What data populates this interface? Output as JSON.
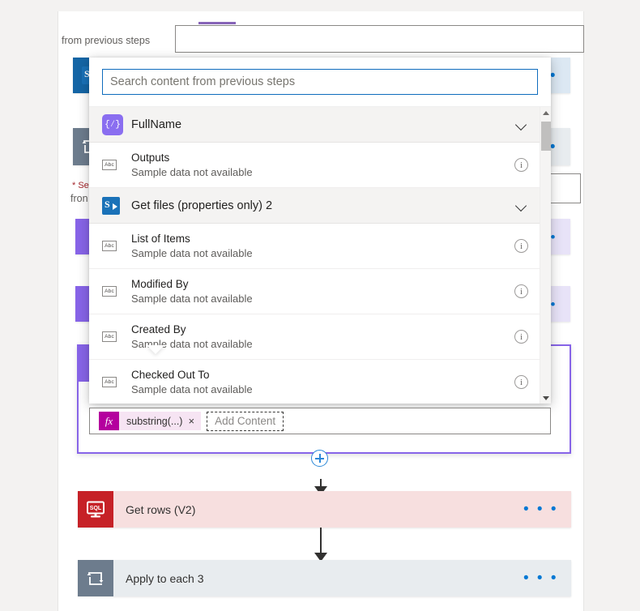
{
  "canvas": {
    "partial_label_top": "from previous steps",
    "required_label_line1": "* Se",
    "required_label_line2": "fron"
  },
  "cards": [
    {
      "name": "sharepoint-card",
      "title": "",
      "type": "sharepoint"
    },
    {
      "name": "apply-to-each-2",
      "title": "",
      "type": "loop"
    }
  ],
  "popup": {
    "search": {
      "placeholder": "Search content from previous steps",
      "value": ""
    },
    "groups": [
      {
        "name": "FullName",
        "icon": "expression-icon",
        "icon_glyph": "{⁄}",
        "chevron": "chevron-down-icon",
        "items": [
          {
            "title": "Outputs",
            "subtitle": "Sample data not available",
            "icon": "abc-icon",
            "info": "info-icon"
          }
        ]
      },
      {
        "name": "Get files (properties only) 2",
        "icon": "sharepoint-icon",
        "chevron": "chevron-down-icon",
        "items": [
          {
            "title": "List of Items",
            "subtitle": "Sample data not available",
            "icon": "abc-icon",
            "info": "info-icon"
          },
          {
            "title": "Modified By",
            "subtitle": "Sample data not available",
            "icon": "abc-icon",
            "info": "info-icon"
          },
          {
            "title": "Created By",
            "subtitle": "Sample data not available",
            "icon": "abc-icon",
            "info": "info-icon"
          },
          {
            "title": "Checked Out To",
            "subtitle": "Sample data not available",
            "icon": "abc-icon",
            "info": "info-icon"
          }
        ]
      }
    ],
    "scrollbar": {
      "up": "scroll-up-arrow",
      "down": "scroll-down-arrow"
    },
    "abc_glyph": "Abc",
    "info_glyph": "i"
  },
  "token_field": {
    "token": {
      "fx_glyph": "fx",
      "label": "substring(...)",
      "remove_glyph": "×"
    },
    "add_content_label": "Add Content"
  },
  "flow": {
    "add_step_button": "plus-icon",
    "steps": [
      {
        "title": "Get rows (V2)",
        "type": "sql",
        "icon": "sql-icon",
        "menu": "• • •"
      },
      {
        "title": "Apply to each 3",
        "type": "loop",
        "icon": "loop-icon",
        "menu": "• • •"
      }
    ]
  },
  "colors": {
    "accent": "#0078d4",
    "sharepoint": "#1465a5",
    "sql": "#c62127",
    "loop": "#6d7c8d",
    "expression": "#8764e8",
    "token_fx": "#b4009e"
  }
}
